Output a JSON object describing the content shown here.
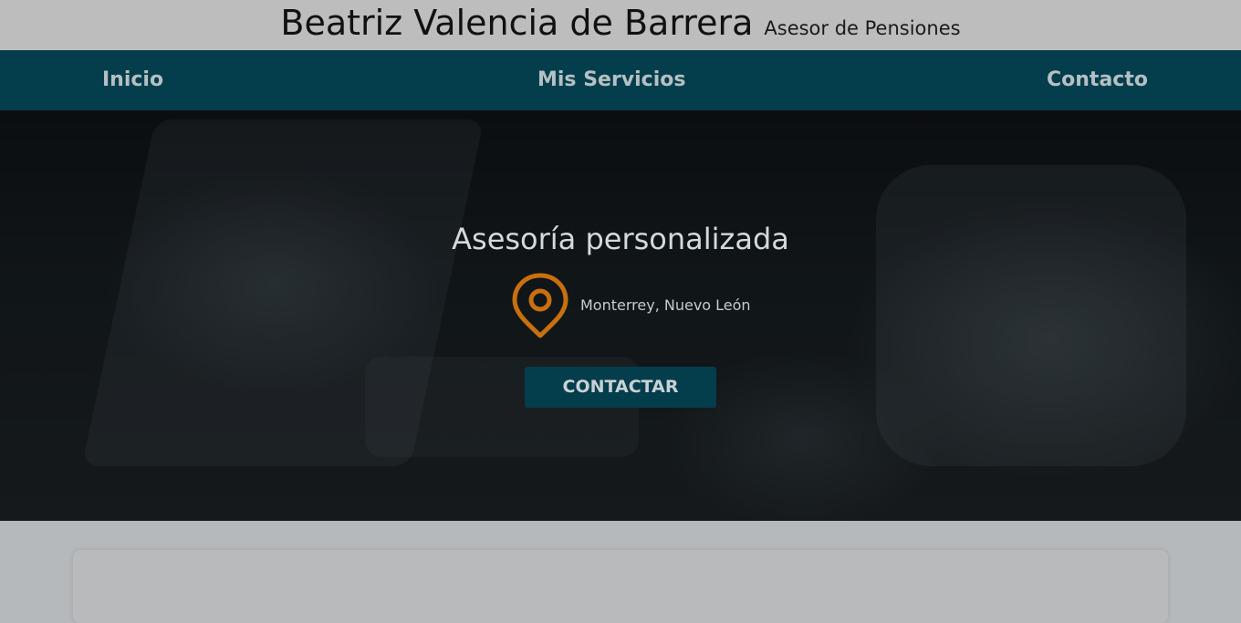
{
  "header": {
    "name": "Beatriz Valencia de Barrera",
    "role": "Asesor de Pensiones"
  },
  "nav": {
    "items": [
      {
        "label": "Inicio"
      },
      {
        "label": "Mis Servicios"
      },
      {
        "label": "Contacto"
      }
    ]
  },
  "hero": {
    "title": "Asesoría personalizada",
    "location": "Monterrey, Nuevo León",
    "location_icon": "map-pin-icon",
    "cta_label": "CONTACTAR"
  },
  "colors": {
    "header_bg": "#bdbdbd",
    "nav_bg": "#043d4c",
    "accent_pin": "#c8700f",
    "button_bg": "#043d4c"
  }
}
